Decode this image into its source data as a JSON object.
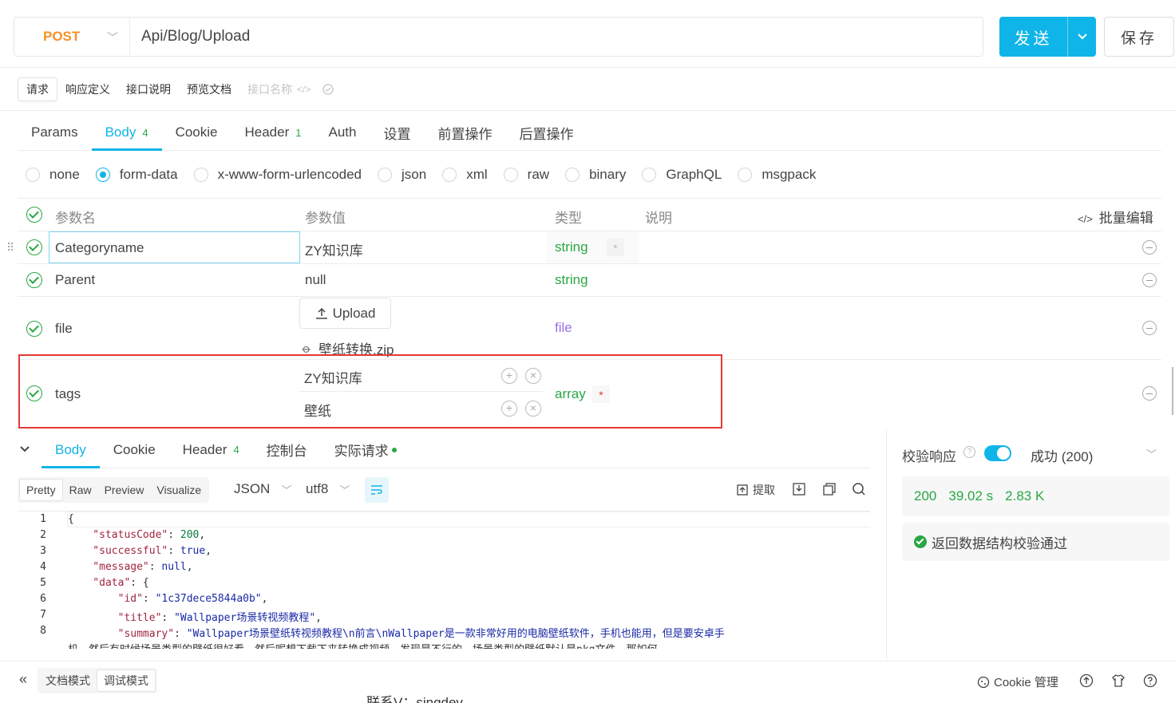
{
  "request": {
    "method": "POST",
    "url": "Api/Blog/Upload",
    "send_label": "发送",
    "save_label": "保存"
  },
  "mode_tabs": [
    "请求",
    "响应定义",
    "接口说明",
    "预览文档"
  ],
  "mode_placeholder": "接口名称",
  "request_tabs": [
    {
      "label": "Params",
      "count": ""
    },
    {
      "label": "Body",
      "count": "4"
    },
    {
      "label": "Cookie",
      "count": ""
    },
    {
      "label": "Header",
      "count": "1"
    },
    {
      "label": "Auth",
      "count": ""
    },
    {
      "label": "设置",
      "count": ""
    },
    {
      "label": "前置操作",
      "count": ""
    },
    {
      "label": "后置操作",
      "count": ""
    }
  ],
  "body_types": [
    "none",
    "form-data",
    "x-www-form-urlencoded",
    "json",
    "xml",
    "raw",
    "binary",
    "GraphQL",
    "msgpack"
  ],
  "body_type_selected": "form-data",
  "params_table": {
    "headers": {
      "name": "参数名",
      "value": "参数值",
      "type": "类型",
      "desc": "说明",
      "bulk": "批量编辑"
    },
    "rows": [
      {
        "name": "Categoryname",
        "value": "ZY知识库",
        "type": "string",
        "required_mark": "*"
      },
      {
        "name": "Parent",
        "value": "null",
        "type": "string"
      },
      {
        "name": "file",
        "upload_label": "Upload",
        "file_name": "壁纸转换.zip",
        "type": "file"
      },
      {
        "name": "tags",
        "values": [
          "ZY知识库",
          "壁纸"
        ],
        "type": "array",
        "required_mark": "*"
      }
    ]
  },
  "response_tabs": [
    {
      "label": "Body",
      "count": ""
    },
    {
      "label": "Cookie",
      "count": ""
    },
    {
      "label": "Header",
      "count": "4"
    },
    {
      "label": "控制台",
      "count": ""
    },
    {
      "label": "实际请求",
      "count": ""
    }
  ],
  "view_tabs": [
    "Pretty",
    "Raw",
    "Preview",
    "Visualize"
  ],
  "format": "JSON",
  "encoding": "utf8",
  "extract_label": "提取",
  "code_lines": [
    "{",
    "    \"statusCode\": 200,",
    "    \"successful\": true,",
    "    \"message\": null,",
    "    \"data\": {",
    "        \"id\": \"1c37dece5844a0b\",",
    "        \"title\": \"Wallpaper场景转视频教程\",",
    "        \"summary\": \"Wallpaper场景壁纸转视频教程\\n前言\\nWallpaper是一款非常好用的电脑壁纸软件，手机也能用，但是要安卓手",
    "机。然后有时候场景类型的壁纸很好看，然后呢想下载下来转换成视频，发现是不行的。场景类型的壁纸默认是pkg文件，那如何"
  ],
  "validation": {
    "label": "校验响应",
    "status": "成功 (200)",
    "code": "200",
    "time": "39.02 s",
    "size": "2.83 K",
    "message": "返回数据结构校验通过"
  },
  "bottom": {
    "doc_mode": "文档模式",
    "debug_mode": "调试模式",
    "cookie_label": "Cookie 管理",
    "overflow_text": "联系V：singdev"
  },
  "colors": {
    "accent": "#0fb4e8",
    "method": "#f5922a",
    "green": "#29a745",
    "highlight": "#e53935"
  }
}
